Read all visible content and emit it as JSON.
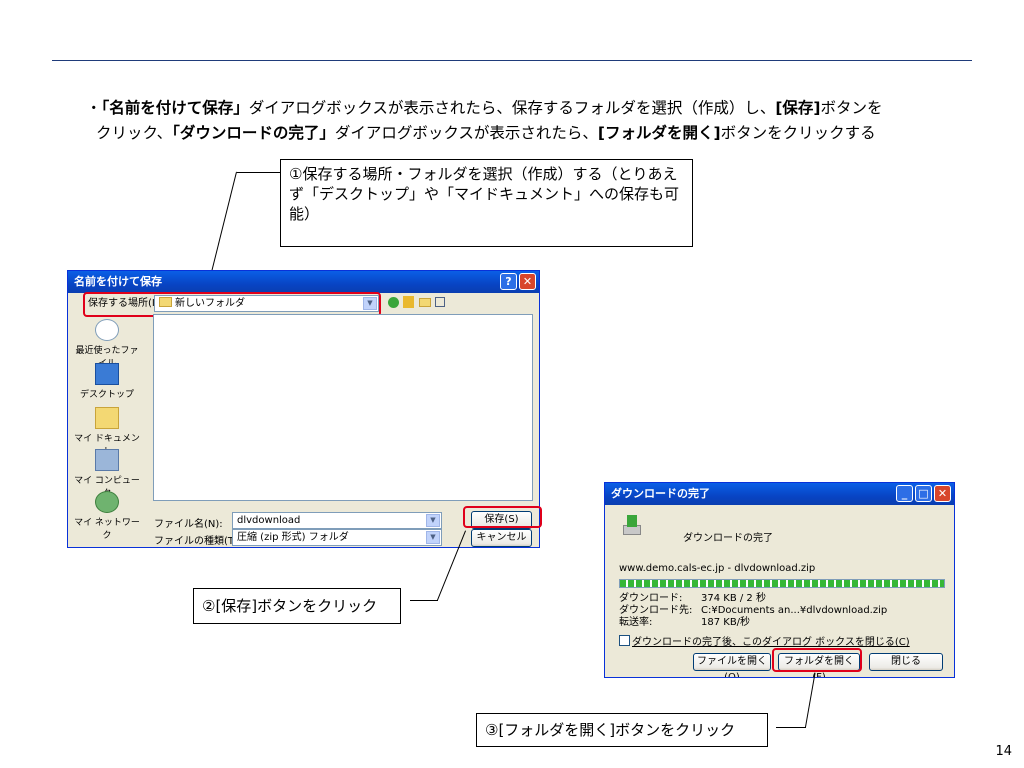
{
  "slide": {
    "bullet_prefix": "・",
    "bullet_parts": [
      {
        "t": "「名前を付けて保存」",
        "b": true
      },
      {
        "t": "ダイアログボックスが表示されたら、保存するフォルダを選択（作成）し、",
        "b": false
      },
      {
        "t": "[保存]",
        "b": true
      },
      {
        "t": "ボタンを",
        "b": false
      }
    ],
    "bullet_parts_line2": [
      {
        "t": "クリック、",
        "b": false
      },
      {
        "t": "「ダウンロードの完了」",
        "b": true
      },
      {
        "t": "ダイアログボックスが表示されたら、",
        "b": false
      },
      {
        "t": "[フォルダを開く]",
        "b": true
      },
      {
        "t": "ボタンをクリックする",
        "b": false
      }
    ],
    "callout1": "①保存する場所・フォルダを選択（作成）する（とりあえず「デスクトップ」や「マイドキュメント」への保存も可能）",
    "callout2": "②[保存]ボタンをクリック",
    "callout3": "③[フォルダを開く]ボタンをクリック",
    "page_number": "14"
  },
  "save_dialog": {
    "title": "名前を付けて保存",
    "help_btn": "?",
    "close_btn": "✕",
    "location_label": "保存する場所(I):",
    "location_value": "新しいフォルダ",
    "places": [
      "最近使ったファイル",
      "デスクトップ",
      "マイ ドキュメント",
      "マイ コンピュータ",
      "マイ ネットワーク"
    ],
    "filename_label": "ファイル名(N):",
    "filename_value": "dlvdownload",
    "filetype_label": "ファイルの種類(T):",
    "filetype_value": "圧縮 (zip 形式) フォルダ",
    "save_btn": "保存(S)",
    "cancel_btn": "キャンセル"
  },
  "complete_dialog": {
    "title": "ダウンロードの完了",
    "heading": "ダウンロードの完了",
    "url": "www.demo.cals-ec.jp - dlvdownload.zip",
    "progress": 1.0,
    "rows": [
      {
        "label": "ダウンロード:",
        "value": "374 KB / 2 秒"
      },
      {
        "label": "ダウンロード先:",
        "value": "C:¥Documents an...¥dlvdownload.zip"
      },
      {
        "label": "転送率:",
        "value": "187 KB/秒"
      }
    ],
    "checkbox_label": "ダウンロードの完了後、このダイアログ ボックスを閉じる(C)",
    "open_file_btn": "ファイルを開く(O)",
    "open_folder_btn": "フォルダを開く(F)",
    "close_btn": "閉じる"
  },
  "colors": {
    "accent_red": "#e0001a",
    "xp_blue": "#0a5fe6",
    "rule": "#1f3b7a"
  }
}
